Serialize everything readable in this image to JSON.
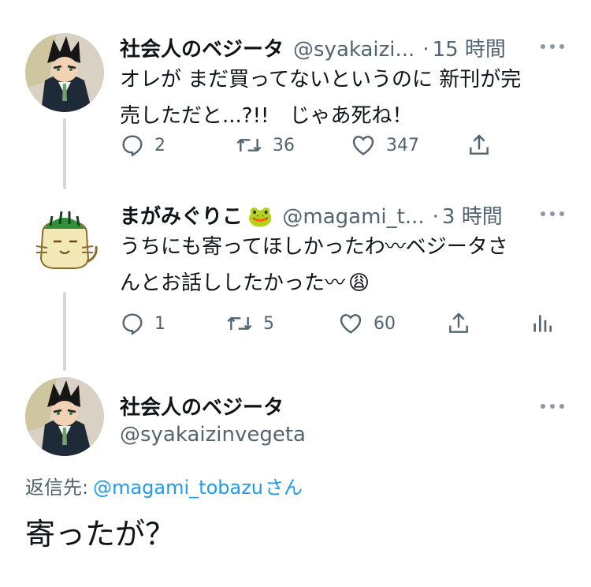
{
  "tweets": [
    {
      "name": "社会人のベジータ",
      "handle": "@syakaizi...",
      "time": "15 時間",
      "lines": [
        "オレが まだ買ってないというのに 新刊が完",
        "売しただと...?!!　じゃあ死ね！"
      ],
      "replies": "2",
      "retweets": "36",
      "likes": "347"
    },
    {
      "name": "まがみぐりこ",
      "name_emoji": "🐸",
      "handle": "@magami_t...",
      "time": "3 時間",
      "lines": [
        "うちにも寄ってほしかったわ〰ベジータさ",
        "んとお話ししたかった〰"
      ],
      "line_emoji": "😩",
      "replies": "1",
      "retweets": "5",
      "likes": "60"
    }
  ],
  "main_tweet": {
    "name": "社会人のベジータ",
    "handle": "@syakaizinvegeta",
    "reply_to_label": "返信先:",
    "reply_to_mention": "@magami_tobazu",
    "reply_to_suffix": "さん",
    "text": "寄ったが？"
  },
  "colors": {
    "text": "#0f1419",
    "secondary": "#536471",
    "link": "#1d9bf0",
    "thread_line": "#cfd9de"
  },
  "icons": [
    "reply-icon",
    "retweet-icon",
    "like-icon",
    "share-icon",
    "analytics-icon",
    "more-icon"
  ]
}
